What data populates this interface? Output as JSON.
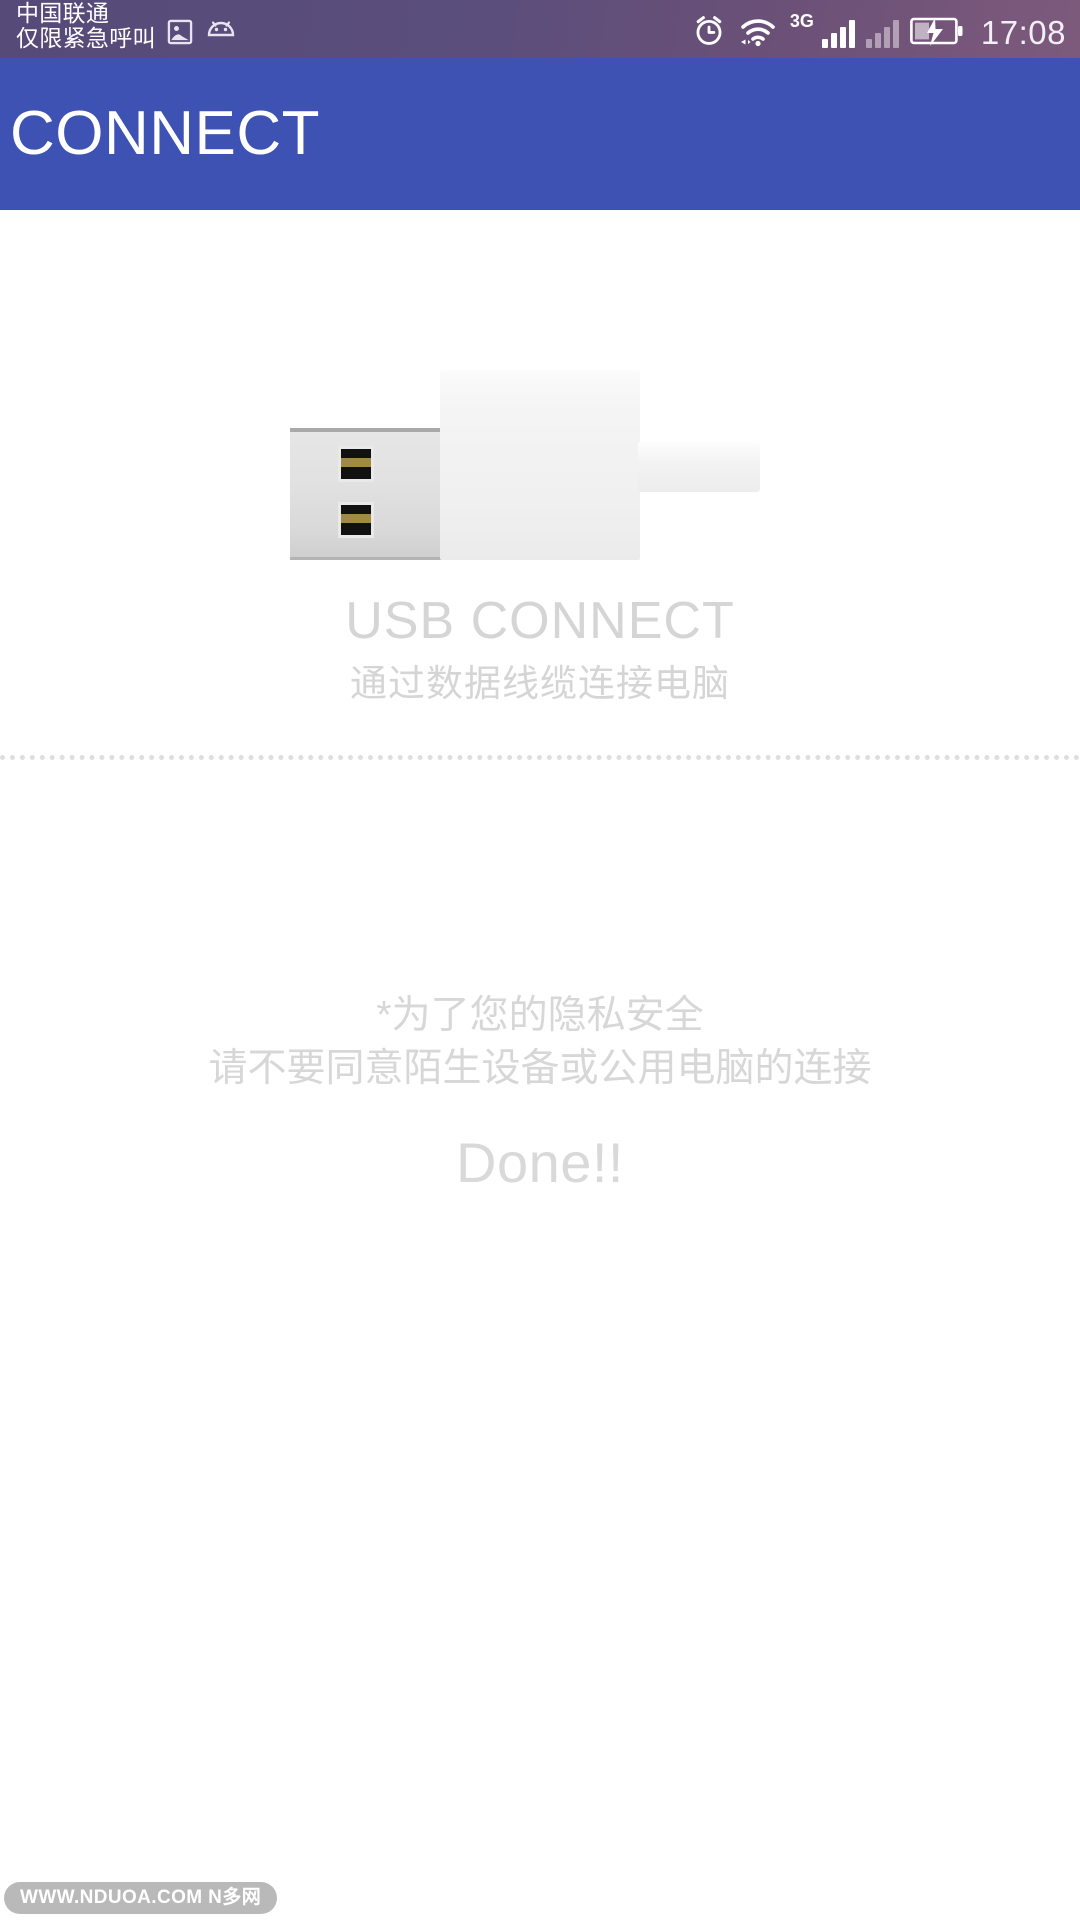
{
  "status_bar": {
    "carrier_line_1": "中国联通",
    "carrier_line_2": "仅限紧急呼叫",
    "photo_icon": "photo-icon",
    "android_icon": "android-robot-icon",
    "alarm_icon": "alarm-clock-icon",
    "wifi_icon": "wifi-icon",
    "network_type": "3G",
    "signal_icon_1": "signal-bars-icon",
    "signal_icon_2": "signal-bars-secondary-icon",
    "battery_icon": "battery-charging-icon",
    "time": "17:08",
    "background_color": "#564a78"
  },
  "app_bar": {
    "title": "CONNECT",
    "background_color": "#3d52b3",
    "text_color": "#ffffff"
  },
  "main": {
    "usb_illustration_name": "usb-connector-illustration",
    "heading": "USB CONNECT",
    "subheading": "通过数据线缆连接电脑",
    "heading_color": "#d5d5d5",
    "notice_lines": [
      "*为了您的隐私安全",
      "请不要同意陌生设备或公用电脑的连接"
    ],
    "done_label": "Done!!",
    "notice_color": "#d7d7d7"
  },
  "watermark": {
    "text": "WWW.NDUOA.COM N多网",
    "background_color": "#b9b9b9"
  }
}
